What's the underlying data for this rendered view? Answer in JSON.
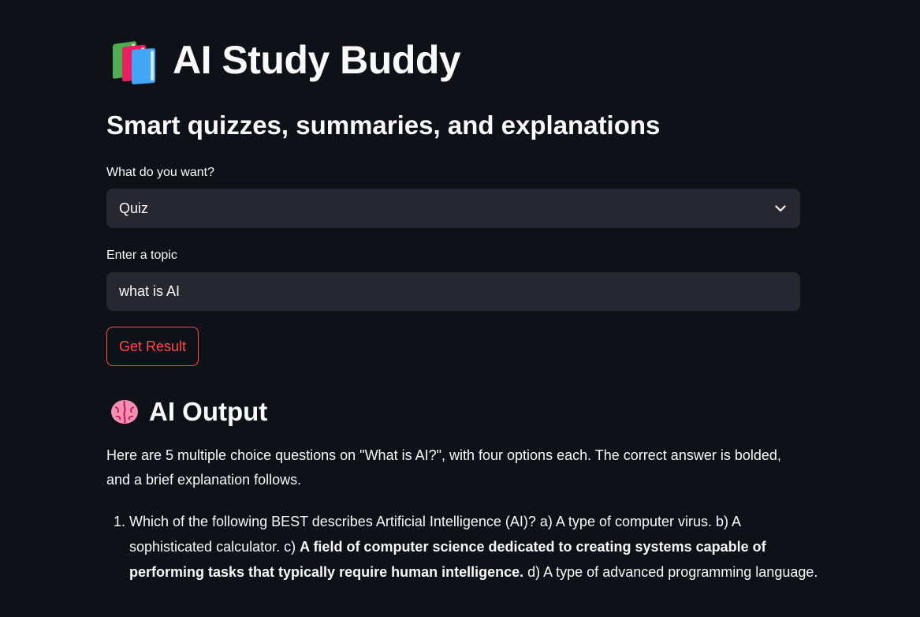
{
  "app": {
    "title": "AI Study Buddy",
    "subtitle": "Smart quizzes, summaries, and explanations"
  },
  "form": {
    "mode_label": "What do you want?",
    "mode_value": "Quiz",
    "topic_label": "Enter a topic",
    "topic_value": "what is AI",
    "submit_label": "Get Result"
  },
  "output": {
    "heading": "AI Output",
    "intro": "Here are 5 multiple choice questions on \"What is AI?\", with four options each. The correct answer is bolded, and a brief explanation follows.",
    "questions": [
      {
        "before": "Which of the following BEST describes Artificial Intelligence (AI)? a) A type of computer virus. b) A sophisticated calculator. c) ",
        "bold": "A field of computer science dedicated to creating systems capable of performing tasks that typically require human intelligence.",
        "after": " d) A type of advanced programming language."
      }
    ]
  },
  "icons": {
    "title_icon": "books-icon",
    "output_icon": "brain-icon",
    "select_icon": "chevron-down-icon"
  },
  "colors": {
    "background": "#0e1117",
    "input_background": "#262730",
    "accent": "#ff4b4b",
    "text": "#fafafa"
  }
}
